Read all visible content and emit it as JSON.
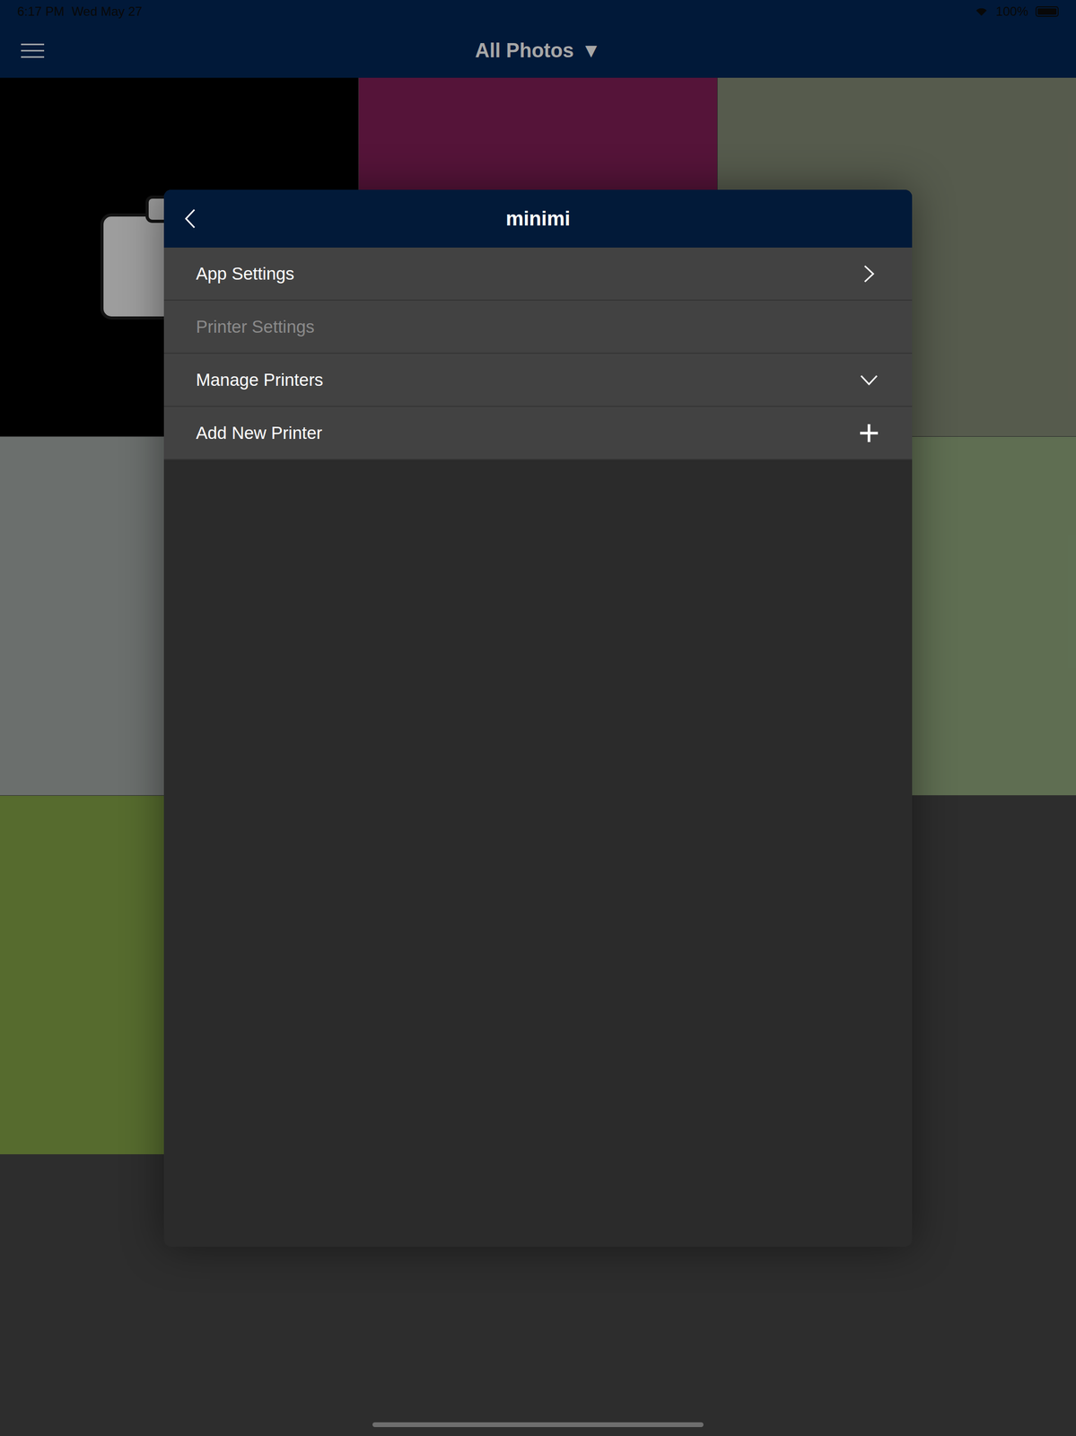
{
  "status_bar": {
    "time": "6:17 PM",
    "date": "Wed May 27",
    "battery": "100%",
    "battery_level": 1
  },
  "nav": {
    "title": "All Photos",
    "dropdown": "▼"
  },
  "photos": [
    {
      "kind": "camera",
      "color": "#000000"
    },
    {
      "kind": "photo",
      "color": "#6e1a4a"
    },
    {
      "kind": "photo",
      "color": "#6f7563"
    },
    {
      "kind": "photo",
      "color": "#8a8f8c"
    },
    {
      "kind": "photo",
      "color": "#4d5a3a"
    },
    {
      "kind": "photo",
      "color": "#7a8e6a"
    },
    {
      "kind": "photo",
      "color": "#6f8a3c"
    }
  ],
  "dialog": {
    "title": "minimi",
    "items": [
      {
        "label": "App Settings",
        "kind": "link",
        "disabled": false,
        "expanded": false
      },
      {
        "label": "Printer Settings",
        "kind": "plain",
        "disabled": true,
        "expanded": false
      },
      {
        "label": "Manage Printers",
        "kind": "expand",
        "disabled": false,
        "expanded": false
      },
      {
        "label": "Add New Printer",
        "kind": "add",
        "disabled": false,
        "expanded": false
      }
    ]
  }
}
